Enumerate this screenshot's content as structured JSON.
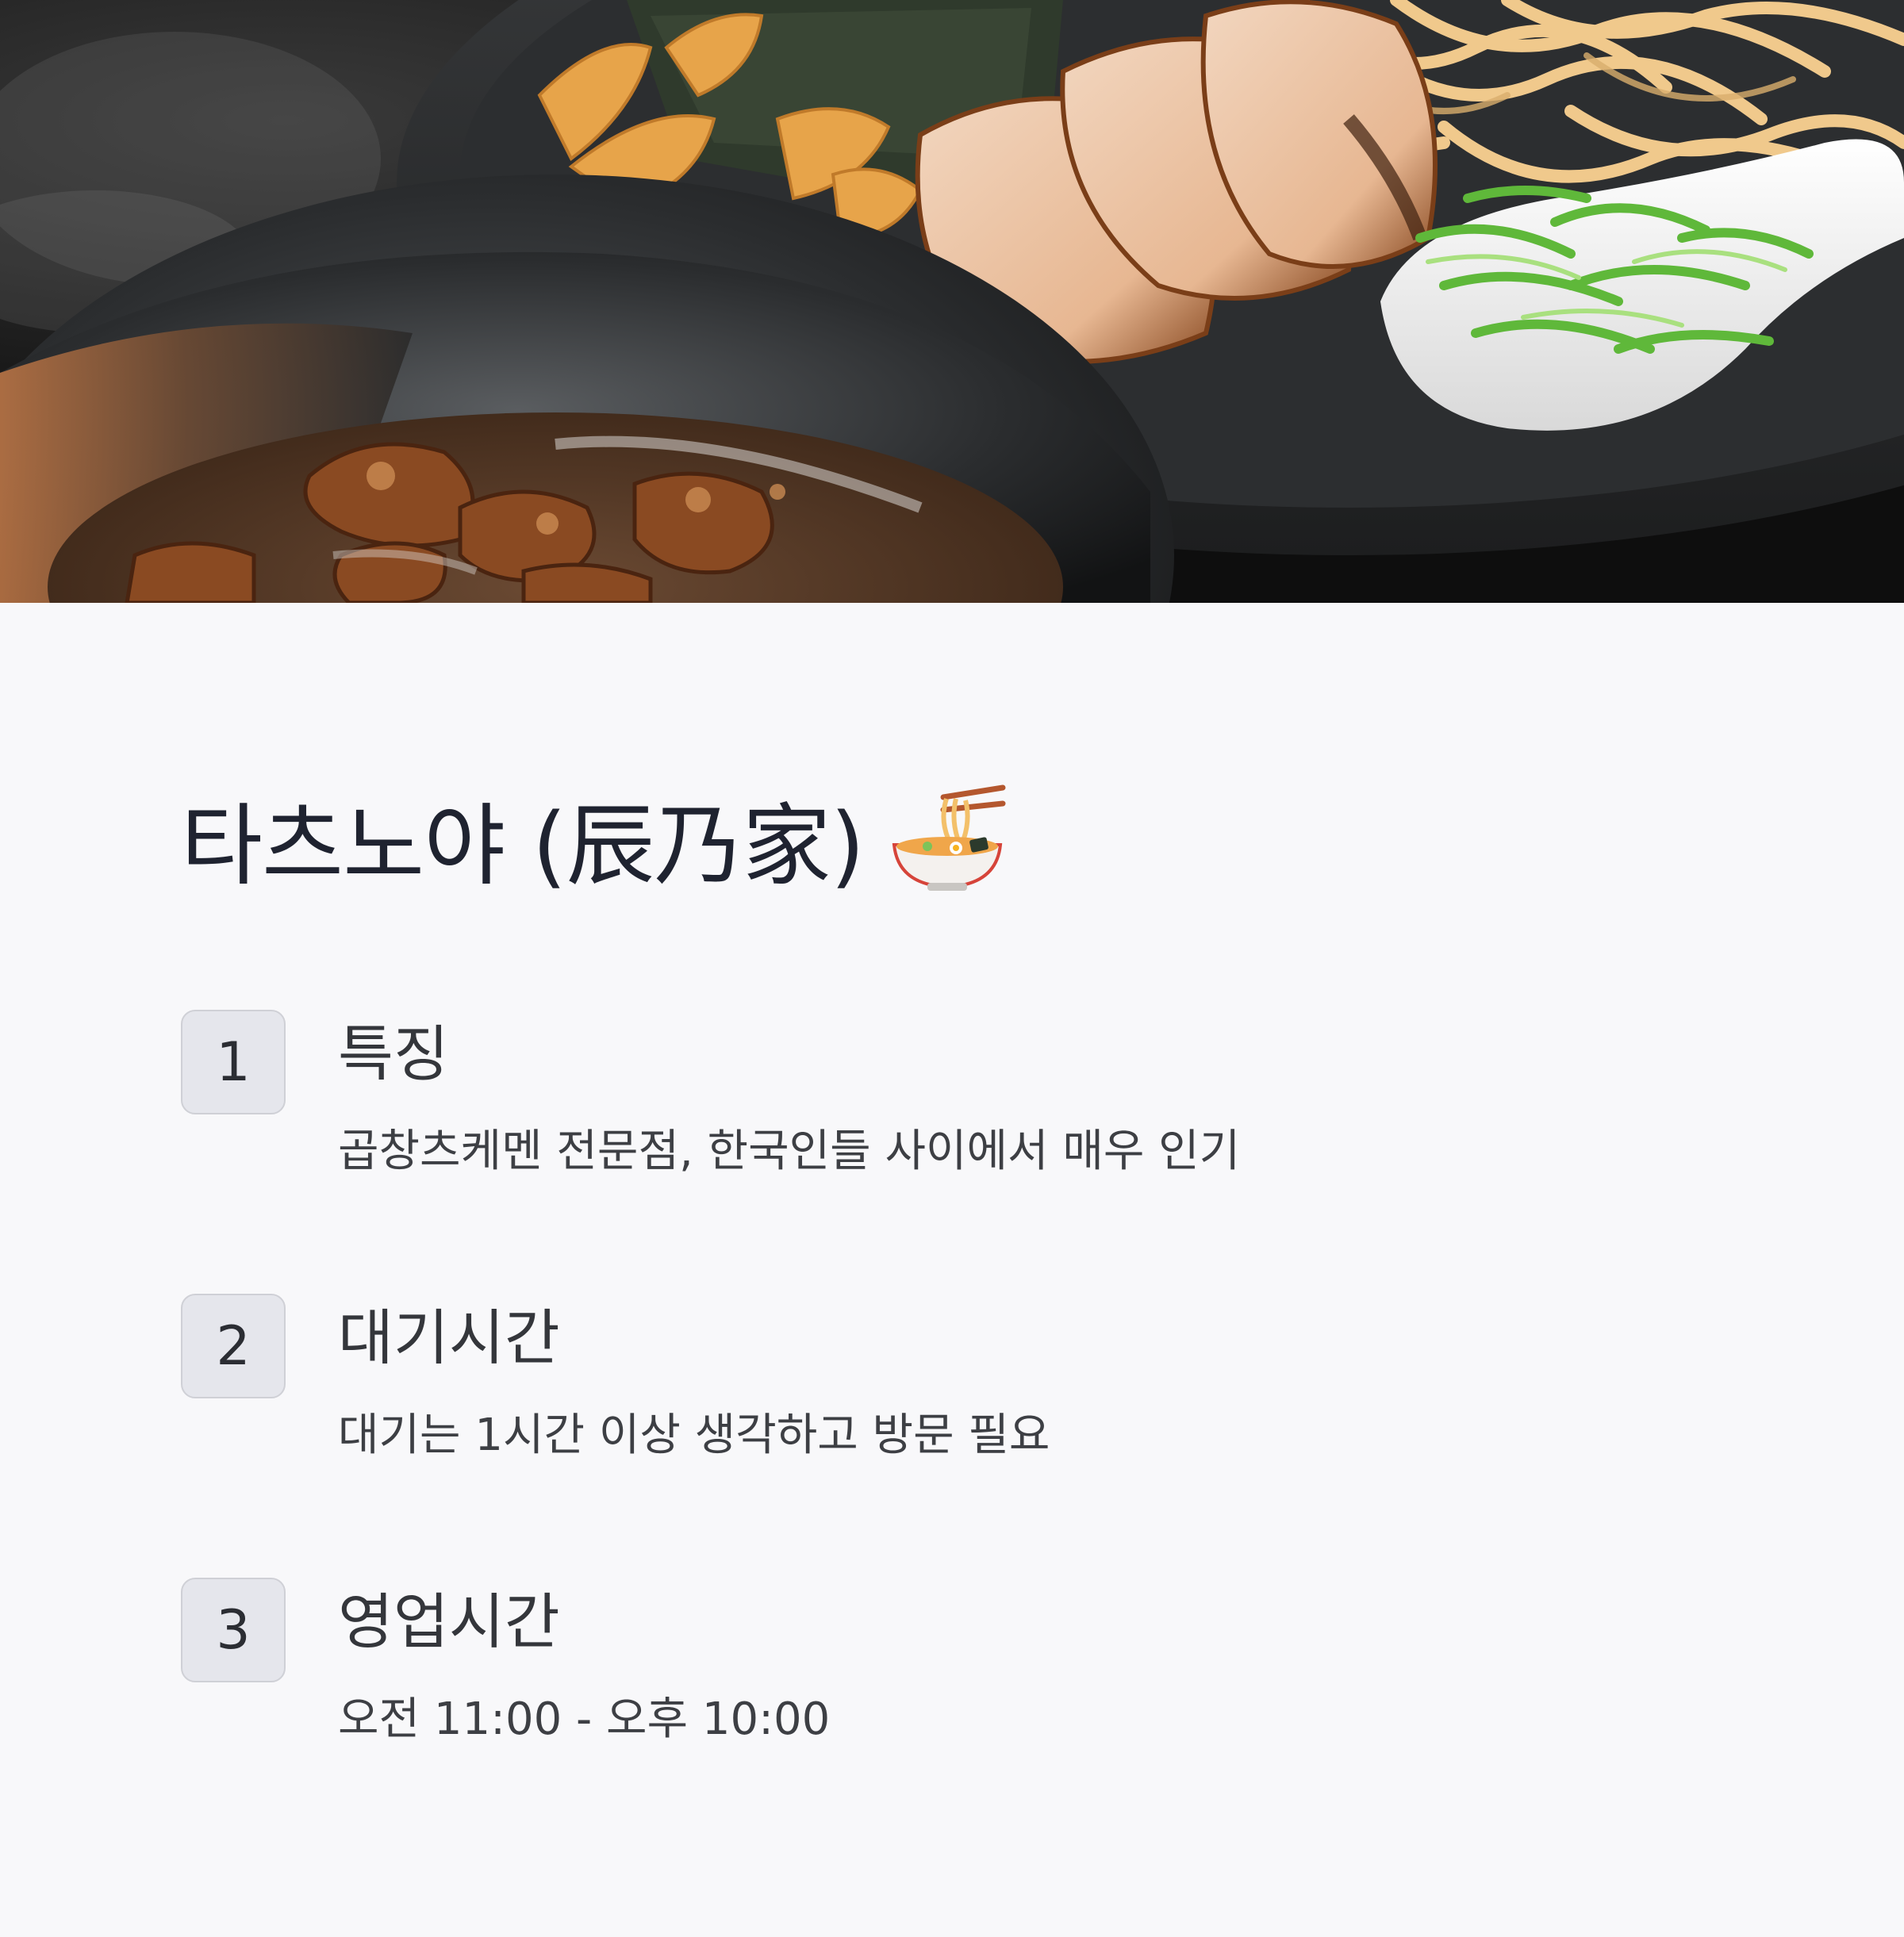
{
  "header": {
    "image_alt": "tsukemen-photo",
    "title": "타츠노야 (辰乃家)",
    "title_icon": "ramen-bowl-icon"
  },
  "items": [
    {
      "number": "1",
      "heading": "특징",
      "description": "곱창츠케멘 전문점, 한국인들 사이에서 매우 인기"
    },
    {
      "number": "2",
      "heading": "대기시간",
      "description": "대기는 1시간 이상 생각하고 방문 필요"
    },
    {
      "number": "3",
      "heading": "영업시간",
      "description": "오전 11:00 - 오후 10:00"
    }
  ],
  "colors": {
    "background": "#f8f8fa",
    "badge_bg": "#e5e6ec",
    "badge_border": "#cfd0d6",
    "title_text": "#1f2330",
    "body_text": "#3d3f44"
  }
}
